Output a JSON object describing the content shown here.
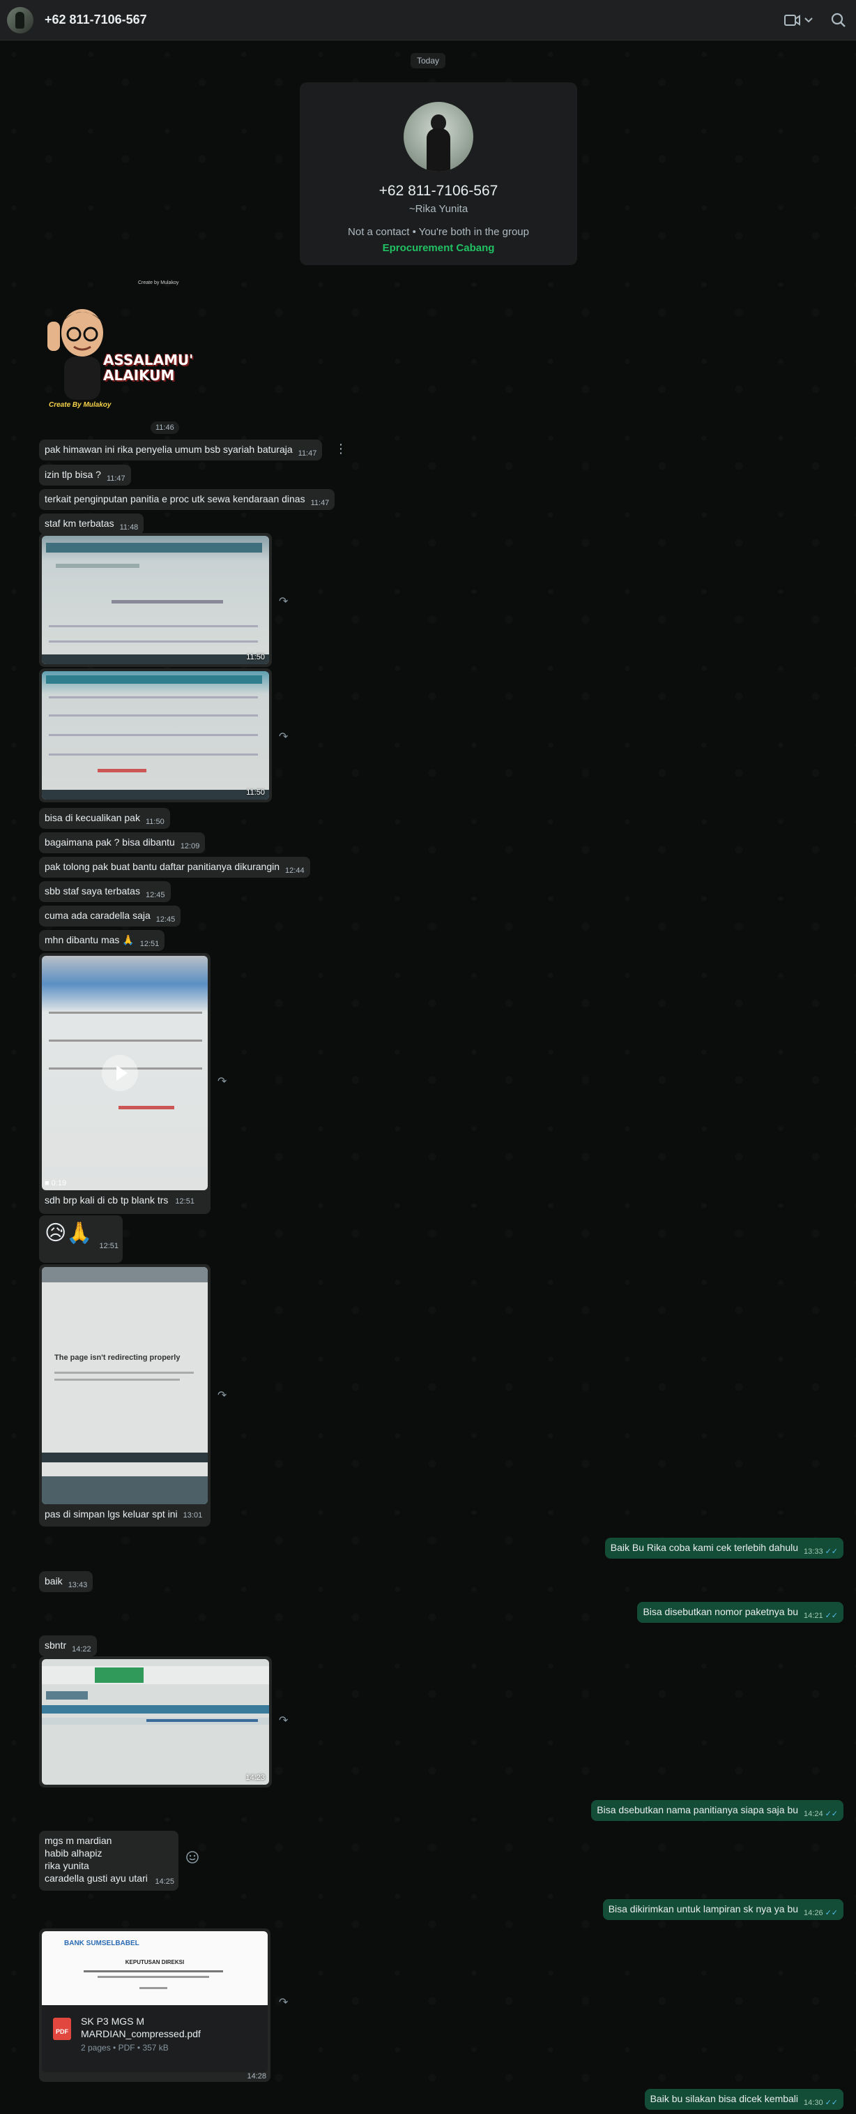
{
  "header": {
    "title": "+62 811-7106-567"
  },
  "date_divider": "Today",
  "contact_card": {
    "phone": "+62 811-7106-567",
    "name": "~Rika Yunita",
    "note": "Not a contact • You're both in the group",
    "group": "Eprocurement Cabang"
  },
  "sticker": {
    "caption": "Create by Mulakoy",
    "line1": "ASSALAMU'",
    "line2": "ALAIKUM",
    "credit": "Create By Mulakoy",
    "time": "11:46"
  },
  "messages": [
    {
      "text": "pak himawan ini rika penyelia umum bsb syariah baturaja",
      "time": "11:47"
    },
    {
      "text": "izin tlp bisa ?",
      "time": "11:47"
    },
    {
      "text": "terkait penginputan panitia e proc utk sewa kendaraan dinas",
      "time": "11:47"
    },
    {
      "text": "staf km terbatas",
      "time": "11:48"
    },
    {
      "text": "bisa di kecualikan pak",
      "time": "11:50"
    },
    {
      "text": "bagaimana pak ? bisa dibantu",
      "time": "12:09"
    },
    {
      "text": "pak tolong pak buat bantu daftar panitianya dikurangin",
      "time": "12:44"
    },
    {
      "text": "sbb staf saya terbatas",
      "time": "12:45"
    },
    {
      "text": "cuma ada caradella saja",
      "time": "12:45"
    },
    {
      "text": "mhn dibantu mas 🙏",
      "time": "12:51"
    }
  ],
  "images": {
    "img1_time": "11:50",
    "img2_time": "11:50",
    "video_duration": "0:19",
    "video_caption": "sdh brp kali di cb tp blank trs",
    "video_time": "12:51",
    "emoji_msg": "😥🙏",
    "emoji_time": "12:51",
    "error_title": "The page isn't redirecting properly",
    "error_caption": "pas di simpan lgs keluar spt ini",
    "error_time": "13:01",
    "img3_time": "14:23"
  },
  "messages2": [
    {
      "dir": "out",
      "text": "Baik Bu Rika coba kami cek terlebih dahulu",
      "time": "13:33"
    },
    {
      "dir": "in",
      "text": "baik",
      "time": "13:43"
    },
    {
      "dir": "out",
      "text": "Bisa disebutkan nomor paketnya bu",
      "time": "14:21"
    },
    {
      "dir": "in",
      "text": "sbntr",
      "time": "14:22"
    },
    {
      "dir": "out",
      "text": "Bisa dsebutkan nama panitianya siapa saja bu",
      "time": "14:24"
    },
    {
      "dir": "out",
      "text": "Bisa dikirimkan untuk lampiran sk nya ya bu",
      "time": "14:26"
    },
    {
      "dir": "out",
      "text": "Baik bu silakan bisa dicek kembali",
      "time": "14:30"
    }
  ],
  "names_msg": {
    "lines": [
      "mgs m mardian",
      "habib alhapiz",
      "rika yunita",
      "caradella gusti ayu utari"
    ],
    "time": "14:25"
  },
  "pdf": {
    "bank": "BANK SUMSELBABEL",
    "doc_title": "KEPUTUSAN DIREKSI",
    "name": "SK P3 MGS M MARDIAN_compressed.pdf",
    "meta": "2 pages • PDF • 357 kB",
    "icon_label": "PDF",
    "time": "14:28"
  },
  "colors": {
    "accent": "#21c063",
    "outgoing": "#144d37",
    "incoming": "#242626",
    "read_ticks": "#53bdeb"
  }
}
